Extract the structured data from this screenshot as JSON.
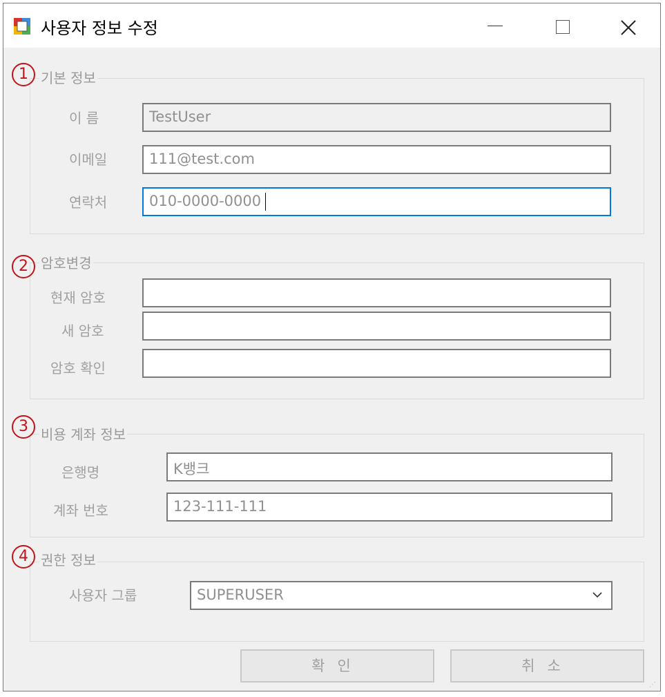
{
  "window": {
    "title": "사용자 정보 수정",
    "controls": {
      "minimize": "minimize",
      "maximize": "maximize",
      "close": "close"
    }
  },
  "groups": {
    "basic": {
      "number": "1",
      "legend": "기본 정보",
      "name_label": "이 름",
      "name_value": "TestUser",
      "email_label": "이메일",
      "email_value": "111@test.com",
      "phone_label": "연락처",
      "phone_value": "010-0000-0000"
    },
    "password": {
      "number": "2",
      "legend": "암호변경",
      "current_label": "현재 암호",
      "current_value": "",
      "new_label": "새 암호",
      "new_value": "",
      "confirm_label": "암호 확인",
      "confirm_value": ""
    },
    "account": {
      "number": "3",
      "legend": "비용 계좌 정보",
      "bank_label": "은행명",
      "bank_value": "K뱅크",
      "account_label": "계좌 번호",
      "account_value": "123-111-111"
    },
    "permission": {
      "number": "4",
      "legend": "권한 정보",
      "group_label": "사용자 그룹",
      "group_value": "SUPERUSER"
    }
  },
  "buttons": {
    "ok": "확인",
    "cancel": "취소"
  },
  "colors": {
    "accent": "#0078d7",
    "marker": "#c0141a",
    "window_bg": "#f0f0f0"
  }
}
